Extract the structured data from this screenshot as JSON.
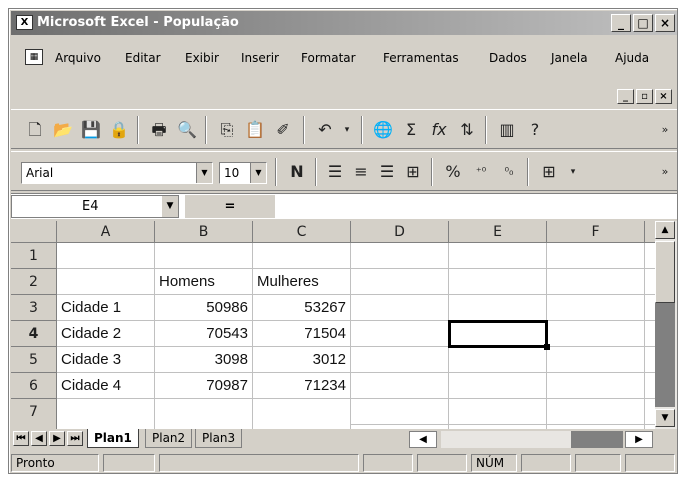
{
  "window": {
    "title": "Microsoft Excel - População"
  },
  "menu": {
    "items": [
      "Arquivo",
      "Editar",
      "Exibir",
      "Inserir",
      "Formatar",
      "Ferramentas",
      "Dados",
      "Janela",
      "Ajuda"
    ]
  },
  "format": {
    "font": "Arial",
    "size": "10"
  },
  "formula": {
    "cell_ref": "E4",
    "equals": "=",
    "content": ""
  },
  "columns": [
    "A",
    "B",
    "C",
    "D",
    "E",
    "F"
  ],
  "rows": [
    {
      "n": "1",
      "a": "",
      "b": "",
      "c": ""
    },
    {
      "n": "2",
      "a": "",
      "b": "Homens",
      "c": "Mulheres"
    },
    {
      "n": "3",
      "a": "Cidade 1",
      "b": "50986",
      "c": "53267"
    },
    {
      "n": "4",
      "a": "Cidade 2",
      "b": "70543",
      "c": "71504"
    },
    {
      "n": "5",
      "a": "Cidade 3",
      "b": "3098",
      "c": "3012"
    },
    {
      "n": "6",
      "a": "Cidade 4",
      "b": "70987",
      "c": "71234"
    },
    {
      "n": "7",
      "a": "",
      "b": "",
      "c": ""
    }
  ],
  "selected_cell": "E4",
  "sheets": [
    "Plan1",
    "Plan2",
    "Plan3"
  ],
  "active_sheet": "Plan1",
  "status": {
    "ready": "Pronto",
    "num": "NÚM"
  }
}
